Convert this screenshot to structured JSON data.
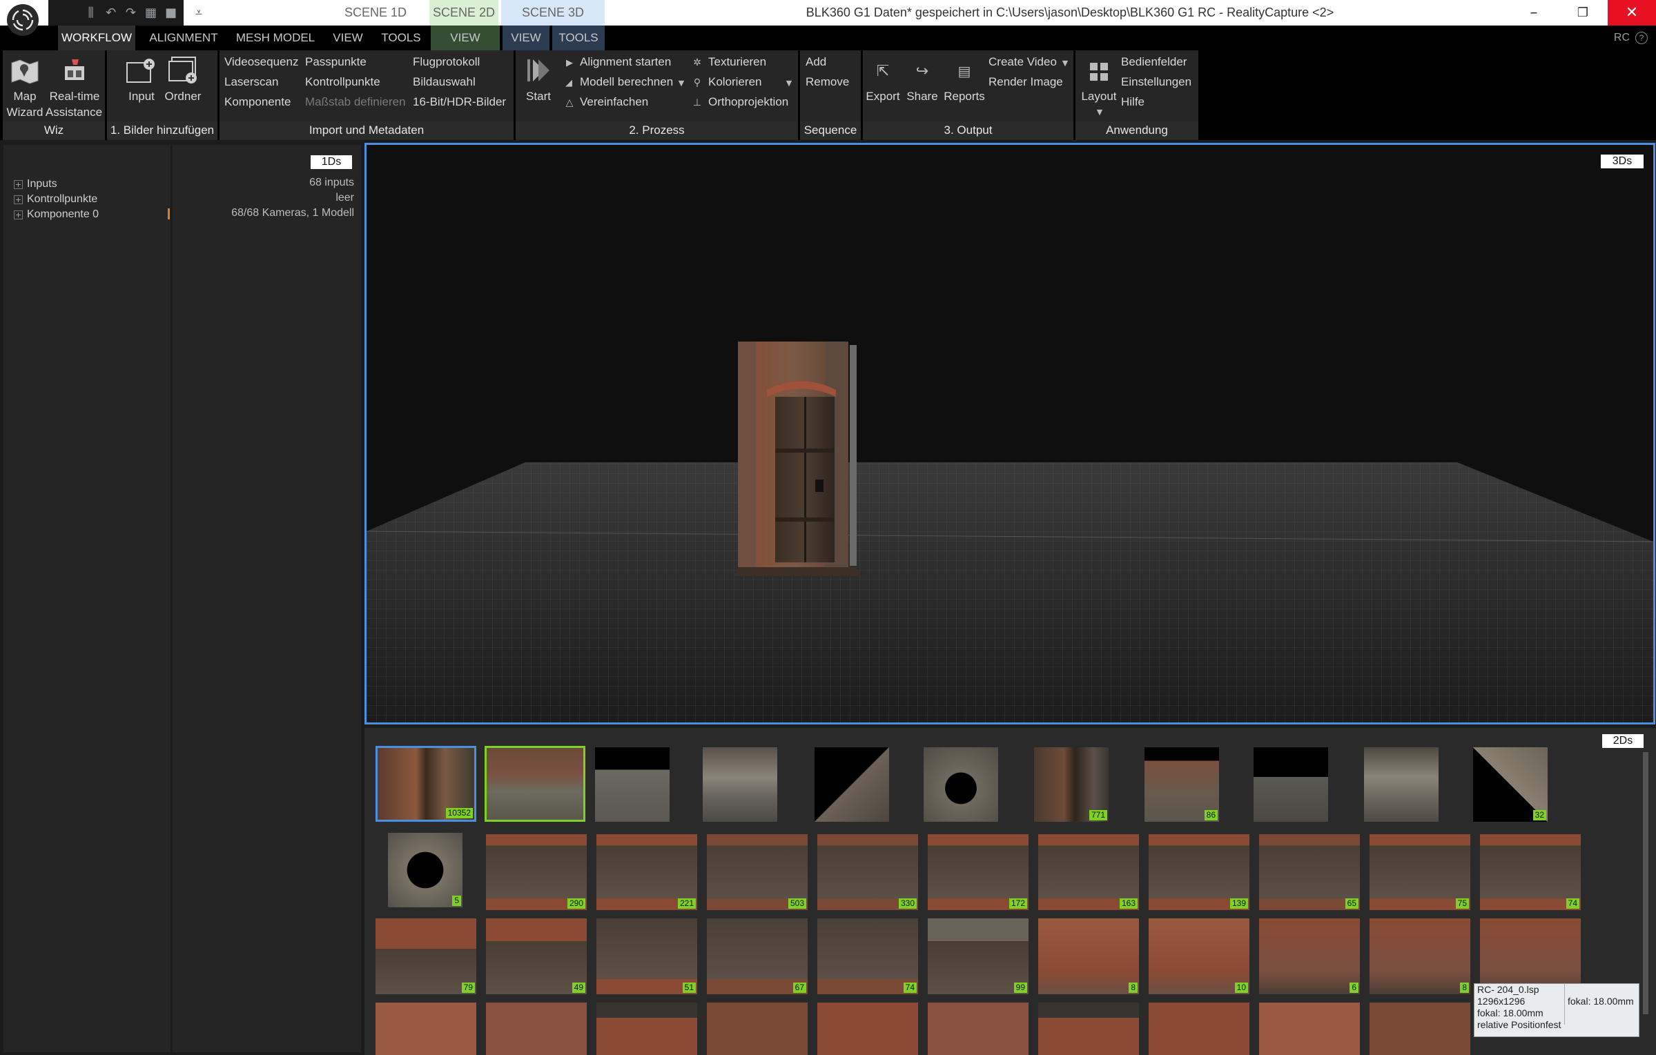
{
  "titlebar": {
    "title": "BLK360 G1 Daten* gespeichert in C:\\Users\\jason\\Desktop\\BLK360 G1 RC - RealityCapture <2>",
    "scene_tabs": [
      "SCENE 1D",
      "SCENE 2D",
      "SCENE 3D"
    ],
    "minimize": "–",
    "restore": "❐",
    "close": "✕"
  },
  "tabs": {
    "workflow": "WORKFLOW",
    "alignment": "ALIGNMENT",
    "mesh_model": "MESH MODEL",
    "view": "VIEW",
    "tools": "TOOLS",
    "scene2d_view": "VIEW",
    "scene3d_view": "VIEW",
    "scene3d_tools": "TOOLS",
    "rc": "RC"
  },
  "ribbon": {
    "wiz": {
      "map": "Map",
      "wizard": "Wizard",
      "realtime": "Real-time",
      "assistance": "Assistance",
      "label": "Wiz"
    },
    "add_images": {
      "input": "Input",
      "folder": "Ordner",
      "label": "1. Bilder hinzufügen"
    },
    "import": {
      "col1": [
        "Videosequenz",
        "Laserscan",
        "Komponente"
      ],
      "col2": [
        "Passpunkte",
        "Kontrollpunkte",
        "Maßstab definieren"
      ],
      "col3": [
        "Flugprotokoll",
        "Bildauswahl",
        "16-Bit/HDR-Bilder"
      ],
      "label": "Import und Metadaten"
    },
    "process": {
      "start": "Start",
      "col1": [
        "Alignment starten",
        "Modell berechnen",
        "Vereinfachen"
      ],
      "col2": [
        "Texturieren",
        "Kolorieren",
        "Orthoprojektion"
      ],
      "label": "2. Prozess"
    },
    "sequence": {
      "add": "Add",
      "remove": "Remove",
      "label": "Sequence"
    },
    "output": {
      "export": "Export",
      "share": "Share",
      "reports": "Reports",
      "create_video": "Create Video",
      "render_image": "Render Image",
      "label": "3. Output"
    },
    "application": {
      "layout": "Layout",
      "items": [
        "Bedienfelder",
        "Einstellungen",
        "Hilfe"
      ],
      "label": "Anwendung"
    }
  },
  "left_panel": {
    "tree": [
      "Inputs",
      "Kontrollpunkte",
      "Komponente 0"
    ]
  },
  "mid_panel": {
    "tag": "1Ds",
    "values": [
      "68 inputs",
      "leer",
      "68/68 Kameras, 1 Modell"
    ]
  },
  "view3d": {
    "tag": "3Ds"
  },
  "view2d": {
    "tag": "2Ds",
    "badges_row1": [
      "10352",
      "",
      "",
      "",
      "",
      "",
      "771",
      "86",
      "",
      "",
      "32"
    ],
    "badges_row2": [
      "5",
      "290",
      "221",
      "503",
      "330",
      "172",
      "163",
      "139",
      "65",
      "75",
      "74"
    ],
    "badges_row3": [
      "79",
      "49",
      "51",
      "67",
      "74",
      "99",
      "8",
      "10",
      "6",
      "8",
      ""
    ],
    "tooltip": [
      "RC- 204_0.lsp",
      "1296x1296",
      "fokal: 18.00mm",
      "relative Positionfest"
    ],
    "tooltip_side": "fokal: 18.00mm"
  }
}
